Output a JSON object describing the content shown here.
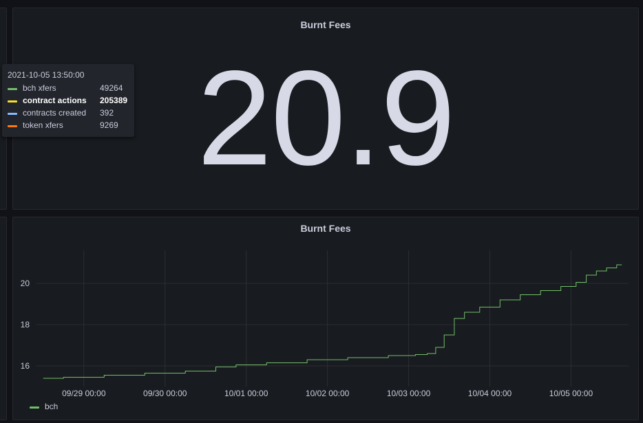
{
  "stat_panel": {
    "title": "Burnt Fees",
    "value": "20.9"
  },
  "tooltip": {
    "time": "2021-10-05 13:50:00",
    "rows": [
      {
        "label": "bch xfers",
        "value": "49264",
        "color": "#73bf69"
      },
      {
        "label": "contract actions",
        "value": "205389",
        "color": "#fade2a"
      },
      {
        "label": "contracts created",
        "value": "392",
        "color": "#8ab8ff"
      },
      {
        "label": "token xfers",
        "value": "9269",
        "color": "#ff780a"
      }
    ]
  },
  "graph_panel": {
    "title": "Burnt Fees",
    "legend": [
      {
        "label": "bch",
        "color": "#73bf69"
      }
    ]
  },
  "chart_data": {
    "type": "line",
    "x_tick_labels": [
      "09/29 00:00",
      "09/30 00:00",
      "10/01 00:00",
      "10/02 00:00",
      "10/03 00:00",
      "10/04 00:00",
      "10/05 00:00"
    ],
    "y_tick_labels": [
      "16",
      "18",
      "20"
    ],
    "y_ticks": [
      16,
      18,
      20
    ],
    "ylim": [
      15.0,
      21.6
    ],
    "xlim": [
      "2021-09-28 10:00",
      "2021-10-05 17:00"
    ],
    "grid": true,
    "legend_position": "bottom-left",
    "series": [
      {
        "name": "bch",
        "color": "#73bf69",
        "x": [
          "2021-09-28 12:00",
          "2021-09-29 00:00",
          "2021-09-29 12:00",
          "2021-09-30 00:00",
          "2021-09-30 12:00",
          "2021-09-30 18:00",
          "2021-10-01 00:00",
          "2021-10-01 12:00",
          "2021-10-02 00:00",
          "2021-10-02 12:00",
          "2021-10-03 00:00",
          "2021-10-03 04:00",
          "2021-10-03 07:00",
          "2021-10-03 09:00",
          "2021-10-03 12:00",
          "2021-10-03 15:00",
          "2021-10-03 18:00",
          "2021-10-04 00:00",
          "2021-10-04 06:00",
          "2021-10-04 12:00",
          "2021-10-04 18:00",
          "2021-10-05 00:00",
          "2021-10-05 03:00",
          "2021-10-05 06:00",
          "2021-10-05 09:00",
          "2021-10-05 12:00",
          "2021-10-05 15:00"
        ],
        "y": [
          15.4,
          15.45,
          15.55,
          15.65,
          15.75,
          15.95,
          16.05,
          16.15,
          16.3,
          16.4,
          16.5,
          16.55,
          16.6,
          16.9,
          17.5,
          18.3,
          18.6,
          18.85,
          19.2,
          19.45,
          19.65,
          19.85,
          20.05,
          20.4,
          20.6,
          20.75,
          20.9
        ]
      }
    ]
  }
}
